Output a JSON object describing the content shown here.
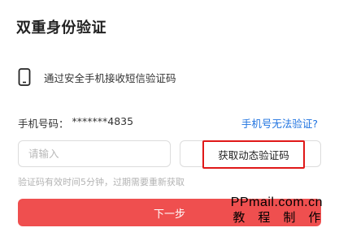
{
  "title": "双重身份验证",
  "method": {
    "icon": "mobile-phone-icon",
    "text": "通过安全手机接收短信验证码"
  },
  "phone": {
    "label": "手机号码：",
    "number": "*******4835",
    "link": "手机号无法验证?"
  },
  "code": {
    "placeholder": "请输入",
    "button": "获取动态验证码"
  },
  "hint": "验证码有效时间5分钟，过期需要重新获取",
  "next_button": "下一步",
  "watermark": {
    "line1": "PPmail.com.cn",
    "line2": "教程制作"
  },
  "colors": {
    "accent": "#ef4f4f",
    "link": "#1f73e0",
    "highlight_border": "#e01818"
  }
}
